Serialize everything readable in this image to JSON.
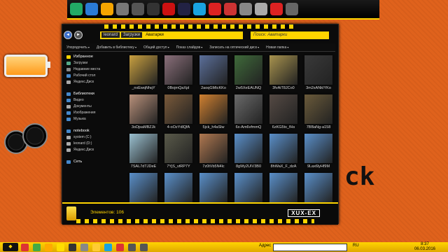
{
  "dock": {
    "icons": [
      {
        "name": "bootcamp-icon",
        "color": "#2a6"
      },
      {
        "name": "desktop-icon",
        "color": "#2a7bd6"
      },
      {
        "name": "messenger-icon",
        "color": "#f5a500"
      },
      {
        "name": "notes-icon",
        "color": "#777"
      },
      {
        "name": "gadget-icon",
        "color": "#555"
      },
      {
        "name": "skull-icon",
        "color": "#333"
      },
      {
        "name": "record-icon",
        "color": "#c11"
      },
      {
        "name": "steam-icon",
        "color": "#224"
      },
      {
        "name": "skype-icon",
        "color": "#19a3e0"
      },
      {
        "name": "stop-icon",
        "color": "#d22"
      },
      {
        "name": "browser-icon",
        "color": "#c33"
      },
      {
        "name": "documents-icon",
        "color": "#888"
      },
      {
        "name": "mail-icon",
        "color": "#aaa"
      },
      {
        "name": "close-icon",
        "color": "#d22"
      },
      {
        "name": "recycle-bin-icon",
        "color": "#666"
      }
    ]
  },
  "explorer": {
    "breadcrumb": [
      "leonard",
      "Загрузки",
      "Аватарки"
    ],
    "search_placeholder": "Поиск: Аватарки",
    "toolbar": [
      "Упорядочить",
      "Добавить в библиотеку",
      "Общий доступ",
      "Показ слайдов",
      "Записать на оптический диск",
      "Новая папка"
    ],
    "sidebar": [
      {
        "label": "Избранное",
        "type": "header",
        "icon": "star-icon",
        "color": "#ffd400"
      },
      {
        "label": "Загрузки",
        "type": "item",
        "icon": "downloads-icon",
        "color": "#5a8"
      },
      {
        "label": "Недавние места",
        "type": "item",
        "icon": "recent-icon",
        "color": "#888"
      },
      {
        "label": "Рабочий стол",
        "type": "item",
        "icon": "desktop-icon",
        "color": "#48c"
      },
      {
        "label": "Яндекс.Диск",
        "type": "item",
        "icon": "cloud-icon",
        "color": "#aaa"
      },
      {
        "label": "",
        "type": "gap"
      },
      {
        "label": "Библиотеки",
        "type": "header",
        "icon": "library-icon",
        "color": "#48c"
      },
      {
        "label": "Видео",
        "type": "item",
        "icon": "video-icon",
        "color": "#48c"
      },
      {
        "label": "Документы",
        "type": "item",
        "icon": "documents-icon",
        "color": "#aaa"
      },
      {
        "label": "Изображения",
        "type": "item",
        "icon": "pictures-icon",
        "color": "#48c"
      },
      {
        "label": "Музыка",
        "type": "item",
        "icon": "music-icon",
        "color": "#48c"
      },
      {
        "label": "",
        "type": "gap"
      },
      {
        "label": "notebook",
        "type": "header",
        "icon": "computer-icon",
        "color": "#48c"
      },
      {
        "label": "system (C:)",
        "type": "item",
        "icon": "drive-icon",
        "color": "#aaa"
      },
      {
        "label": "leonard (D:)",
        "type": "item",
        "icon": "drive-icon",
        "color": "#aaa"
      },
      {
        "label": "Яндекс.Диск",
        "type": "item",
        "icon": "cloud-icon",
        "color": "#aaa"
      },
      {
        "label": "",
        "type": "gap"
      },
      {
        "label": "Сеть",
        "type": "header",
        "icon": "network-icon",
        "color": "#48c"
      }
    ],
    "files": [
      {
        "name": "_nxEwqNhqY",
        "color": "#c9a040"
      },
      {
        "name": "0BojmQaXpI",
        "color": "#8a6f7a"
      },
      {
        "name": "2aoqGMtcKKo",
        "color": "#5b6f9a"
      },
      {
        "name": "2w5XeEAUNQ",
        "color": "#3f6a3a"
      },
      {
        "name": "3fvAiT8JCo0",
        "color": "#a8934e"
      },
      {
        "name": "3m2xANkIYKo",
        "color": "#3a3a3a"
      },
      {
        "name": "3oDjsaMBZJk",
        "color": "#b8907a"
      },
      {
        "name": "4-oOzYdlQfA",
        "color": "#7a5a3a"
      },
      {
        "name": "5jck_h4aSlw",
        "color": "#d08030"
      },
      {
        "name": "6x-Am6vfmmQ",
        "color": "#6a6a6a"
      },
      {
        "name": "6zKG5tx_fHs",
        "color": "#554a44"
      },
      {
        "name": "7BBaNg-a158",
        "color": "#6a5a3a"
      },
      {
        "name": "7SAL7dTJDeE",
        "color": "#9ac0d0"
      },
      {
        "name": "7YjS_vtRP7Y",
        "color": "#5a5a4a"
      },
      {
        "name": "7z0tVb5N4lc",
        "color": "#b07850"
      },
      {
        "name": "8gWy2UIV3B0",
        "color": "#5a8fc9"
      },
      {
        "name": "8hWaX_F_dzA",
        "color": "#5a8fc9"
      },
      {
        "name": "9Lax6lyHf9M",
        "color": "#5a8fc9"
      },
      {
        "name": "",
        "color": "#5a8fc9"
      },
      {
        "name": "",
        "color": "#5a8fc9"
      },
      {
        "name": "",
        "color": "#5a8fc9"
      },
      {
        "name": "",
        "color": "#5a8fc9"
      },
      {
        "name": "",
        "color": "#5a8fc9"
      },
      {
        "name": "",
        "color": "#5a8fc9"
      }
    ],
    "status_count": "Элементов: 106",
    "brand": "XUX-EX"
  },
  "desktop": {
    "text": "ck"
  },
  "taskbar": {
    "start": "◆",
    "icons": [
      {
        "name": "chrome-icon",
        "color": "#d33"
      },
      {
        "name": "app-icon",
        "color": "#4a4"
      },
      {
        "name": "media-icon",
        "color": "#fa0"
      },
      {
        "name": "explorer-icon",
        "color": "#fd0"
      },
      {
        "name": "player-icon",
        "color": "#333"
      },
      {
        "name": "notes-icon",
        "color": "#888"
      },
      {
        "name": "folder-icon",
        "color": "#fc3"
      },
      {
        "name": "skype-icon",
        "color": "#19a3e0"
      },
      {
        "name": "browser-icon",
        "color": "#d33"
      },
      {
        "name": "image-icon",
        "color": "#555"
      },
      {
        "name": "settings-icon",
        "color": "#555"
      }
    ],
    "address_label": "Адрес",
    "lang": "RU",
    "time": "8:37",
    "date": "06.03.2016"
  }
}
